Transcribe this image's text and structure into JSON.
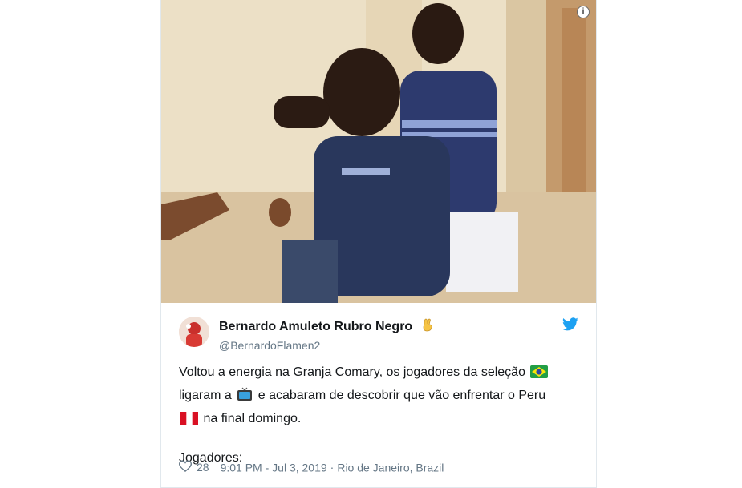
{
  "tweet": {
    "display_name": "Bernardo Amuleto Rubro Negro",
    "name_emoji": "crossed-fingers-emoji",
    "handle": "@BernardoFlamen2",
    "text_part1": "Voltou a energia na Granja Comary, os jogadores da seleção",
    "text_part2": "ligaram a",
    "text_part3": "e acabaram de descobrir que vão enfrentar o Peru",
    "text_part4": "na final domingo.",
    "text_part5": "Jogadores:",
    "emoji1": "brazil-flag-emoji",
    "emoji2": "television-emoji",
    "emoji3": "peru-flag-emoji"
  },
  "footer": {
    "like_count": "28",
    "timestamp": "9:01 PM - Jul 3, 2019",
    "separator": "·",
    "location": "Rio de Janeiro, Brazil"
  },
  "media": {
    "info_label": "i"
  },
  "icons": {
    "platform": "twitter-bird-icon",
    "like": "heart-icon",
    "info": "info-icon"
  },
  "colors": {
    "brand_blue": "#1da1f2",
    "text_primary": "#14171a",
    "text_secondary": "#657786",
    "border": "#e1e8ed"
  }
}
